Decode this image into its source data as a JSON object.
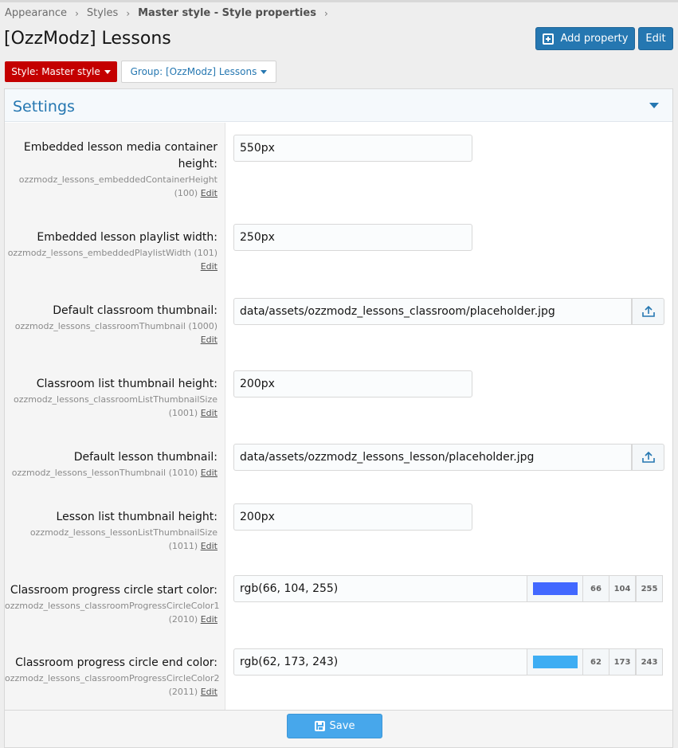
{
  "breadcrumb": [
    {
      "label": "Appearance"
    },
    {
      "label": "Styles"
    },
    {
      "label": "Master style - Style properties"
    }
  ],
  "page": {
    "title": "[OzzModz] Lessons"
  },
  "actions": {
    "add_property": "Add property",
    "edit": "Edit"
  },
  "filters": {
    "style": "Style: Master style",
    "group": "Group: [OzzModz] Lessons"
  },
  "panel": {
    "title": "Settings"
  },
  "rows": [
    {
      "label": "Embedded lesson media container height:",
      "key": "ozzmodz_lessons_embeddedContainerHeight",
      "order": "(100)",
      "edit": "Edit",
      "value": "550px"
    },
    {
      "label": "Embedded lesson playlist width:",
      "key": "ozzmodz_lessons_embeddedPlaylistWidth",
      "order": "(101)",
      "edit": "Edit",
      "value": "250px"
    },
    {
      "label": "Default classroom thumbnail:",
      "key": "ozzmodz_lessons_classroomThumbnail",
      "order": "(1000)",
      "edit": "Edit",
      "value": "data/assets/ozzmodz_lessons_classroom/placeholder.jpg"
    },
    {
      "label": "Classroom list thumbnail height:",
      "key": "ozzmodz_lessons_classroomListThumbnailSize",
      "order": "(1001)",
      "edit": "Edit",
      "value": "200px"
    },
    {
      "label": "Default lesson thumbnail:",
      "key": "ozzmodz_lessons_lessonThumbnail",
      "order": "(1010)",
      "edit": "Edit",
      "value": "data/assets/ozzmodz_lessons_lesson/placeholder.jpg"
    },
    {
      "label": "Lesson list thumbnail height:",
      "key": "ozzmodz_lessons_lessonListThumbnailSize",
      "order": "(1011)",
      "edit": "Edit",
      "value": "200px"
    },
    {
      "label": "Classroom progress circle start color:",
      "key": "ozzmodz_lessons_classroomProgressCircleColor1",
      "order": "(2010)",
      "edit": "Edit",
      "value": "rgb(66, 104, 255)",
      "r": "66",
      "g": "104",
      "b": "255",
      "swatch": "#4268ff"
    },
    {
      "label": "Classroom progress circle end color:",
      "key": "ozzmodz_lessons_classroomProgressCircleColor2",
      "order": "(2011)",
      "edit": "Edit",
      "value": "rgb(62, 173, 243)",
      "r": "62",
      "g": "173",
      "b": "243",
      "swatch": "#3eadf3"
    }
  ],
  "footer": {
    "save": "Save"
  },
  "colors": {
    "accent": "#2577b1",
    "style_button": "#c40000",
    "save_button": "#47a7eb"
  }
}
